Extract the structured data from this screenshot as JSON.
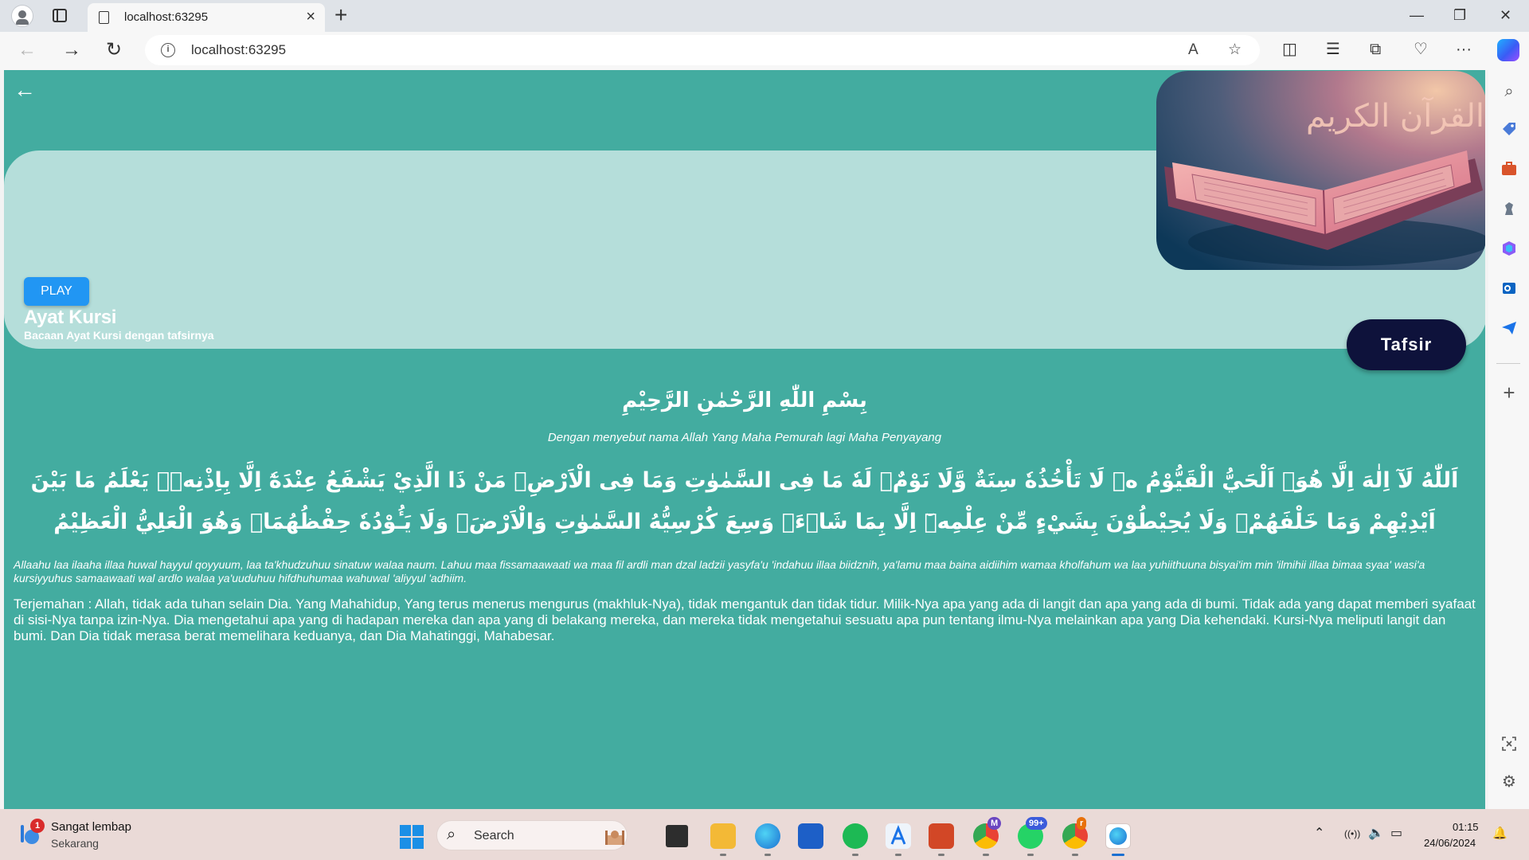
{
  "browser": {
    "tab_title": "localhost:63295",
    "address": "localhost:63295",
    "icons": {
      "new_tab": "+",
      "tab_close": "×",
      "back": "←",
      "forward": "→",
      "reload": "↻",
      "read_aloud": "A",
      "favorite": "☆",
      "split": "◫",
      "favorites": "☰",
      "collections": "⧉",
      "extensions": "♡",
      "more": "···",
      "minimize": "—",
      "restore": "❐",
      "close": "✕"
    }
  },
  "page": {
    "back_icon": "←",
    "play_label": "PLAY",
    "title": "Ayat Kursi",
    "subtitle": "Bacaan Ayat Kursi dengan tafsirnya",
    "tafsir_label": "Tafsir",
    "basmalah": "بِسْمِ اللّٰهِ الرَّحْمٰنِ الرَّحِيْمِ",
    "basmalah_translation": "Dengan menyebut nama Allah Yang Maha Pemurah lagi Maha Penyayang",
    "arabic": "اَللّٰهُ لَآ اِلٰهَ اِلَّا هُوَۚ اَلْحَيُّ الْقَيُّوْمُ ەۚ لَا تَأْخُذُهٗ سِنَةٌ وَّلَا نَوْمٌۗ لَهٗ مَا فِى السَّمٰوٰتِ وَمَا فِى الْاَرْضِۗ مَنْ ذَا الَّذِيْ يَشْفَعُ عِنْدَهٗٓ اِلَّا بِاِذْنِهٖۗ يَعْلَمُ مَا بَيْنَ اَيْدِيْهِمْ وَمَا خَلْفَهُمْۚ وَلَا يُحِيْطُوْنَ بِشَيْءٍ مِّنْ عِلْمِهٖٓ اِلَّا بِمَا شَاۤءَۚ وَسِعَ كُرْسِيُّهُ السَّمٰوٰتِ وَالْاَرْضَۚ وَلَا يَـُٔوْدُهٗ حِفْظُهُمَاۚ وَهُوَ الْعَلِيُّ الْعَظِيْمُ",
    "latin": "Allaahu laa ilaaha illaa huwal hayyul qoyyuum, laa ta'khudzuhuu sinatuw walaa naum. Lahuu maa fissamaawaati wa maa fil ardli man dzal ladzii yasyfa'u 'indahuu illaa biidznih, ya'lamu maa baina aidiihim wamaa kholfahum wa laa yuhiithuuna bisyai'im min 'ilmihii illaa bimaa syaa' wasi'a kursiyyuhus samaawaati wal ardlo walaa ya'uuduhuu hifdhuhumaa wahuwal 'aliyyul 'adhiim.",
    "translation": "Terjemahan : Allah, tidak ada tuhan selain Dia. Yang Mahahidup, Yang terus menerus mengurus (makhluk-Nya), tidak mengantuk dan tidak tidur. Milik-Nya apa yang ada di langit dan apa yang ada di bumi. Tidak ada yang dapat memberi syafaat di sisi-Nya tanpa izin-Nya. Dia mengetahui apa yang di hadapan mereka dan apa yang di belakang mereka, dan mereka tidak mengetahui sesuatu apa pun tentang ilmu-Nya melainkan apa yang Dia kehendaki. Kursi-Nya meliputi langit dan bumi. Dan Dia tidak merasa berat memelihara keduanya, dan Dia Mahatinggi, Mahabesar.",
    "cover_calligraphy": "القرآن الكريم",
    "colors": {
      "background": "#43aca0",
      "panel": "#b5deda",
      "play": "#2196f3",
      "tafsir": "#0e123b"
    }
  },
  "sidebar": {
    "icons": [
      "search-icon",
      "tag-icon",
      "briefcase-icon",
      "chess-icon",
      "office-icon",
      "outlook-icon",
      "send-icon",
      "add-icon",
      "screenshot-icon",
      "settings-icon"
    ],
    "add": "+",
    "search": "⌕",
    "settings": "⚙"
  },
  "taskbar": {
    "weather_title": "Sangat lembap",
    "weather_sub": "Sekarang",
    "weather_badge": "1",
    "search_label": "Search",
    "search_icon": "⌕",
    "whatsapp_badge": "99+",
    "teams_badge": "M",
    "chrome_badge": "r",
    "time": "01:15",
    "date": "24/06/2024",
    "tray_chevron": "⌃",
    "tray_wifi": "((•))",
    "tray_volume": "🔈",
    "tray_battery": "▭",
    "tray_bell": "🔔"
  }
}
